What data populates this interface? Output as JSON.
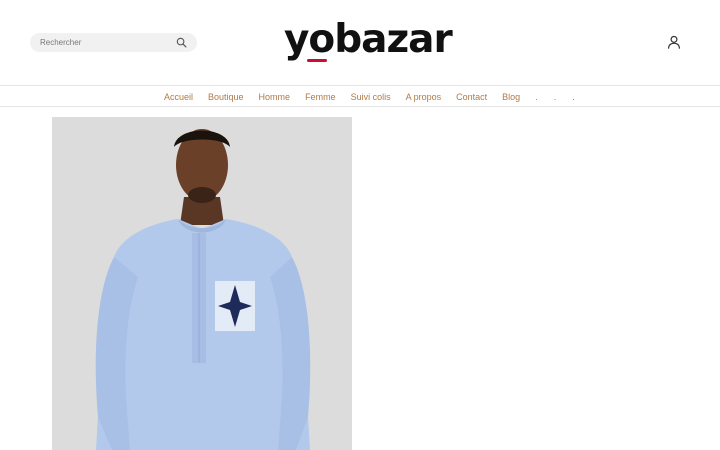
{
  "search": {
    "placeholder": "Rechercher",
    "icon": "search-icon"
  },
  "brand": {
    "logo_text": "yobazar",
    "accent": "#c8102e"
  },
  "account": {
    "icon": "user-icon"
  },
  "nav": {
    "color": "#b07a45",
    "items": [
      {
        "label": "Accueil"
      },
      {
        "label": "Boutique"
      },
      {
        "label": "Homme"
      },
      {
        "label": "Femme"
      },
      {
        "label": "Suivi colis"
      },
      {
        "label": "A propos"
      },
      {
        "label": "Contact"
      },
      {
        "label": "Blog"
      },
      {
        "label": "."
      },
      {
        "label": "."
      },
      {
        "label": "."
      }
    ]
  },
  "product": {
    "background": "#dcdcdc",
    "shirt_color": "#b3c9ec",
    "pocket_motif_color": "#1e2a5a"
  }
}
